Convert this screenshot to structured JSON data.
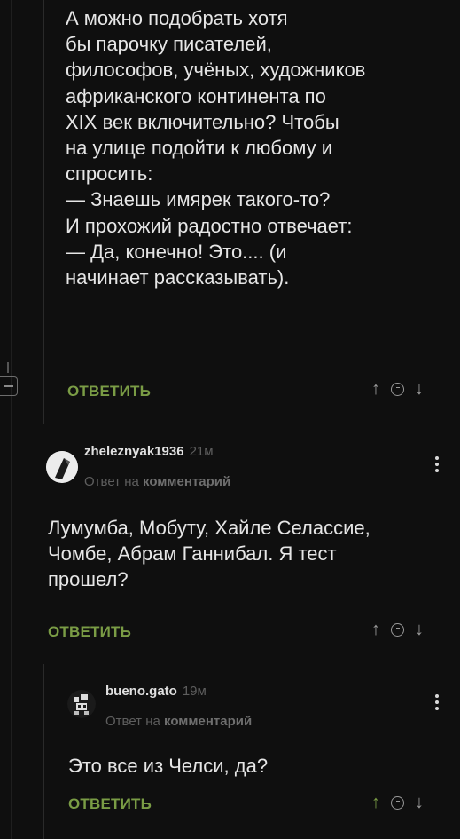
{
  "comments": [
    {
      "text": "А можно подобрать хотя\nбы парочку писателей,\nфилософов, учёных, художников\nафриканского континента по\nXIX век включительно? Чтобы\nна улице подойти к любому и\nспросить:\n— Знаешь имярек такого-то?\nИ прохожий радостно отвечает:\n— Да, конечно! Это.... (и\nначинает рассказывать).",
      "reply_label": "ОТВЕТИТЬ"
    },
    {
      "username": "zheleznyak1936",
      "time": "21м",
      "reply_prefix": "Ответ на",
      "reply_target": "комментарий",
      "text": "Лумумба, Мобуту, Хайле Селассие,\nЧомбе, Абрам Ганнибал. Я тест\nпрошел?",
      "reply_label": "ОТВЕТИТЬ"
    },
    {
      "username": "bueno.gato",
      "time": "19м",
      "reply_prefix": "Ответ на",
      "reply_target": "комментарий",
      "text": "Это все из Челси, да?",
      "reply_label": "ОТВЕТИТЬ"
    }
  ],
  "icons": {
    "upvote": "↑",
    "downvote": "↓"
  },
  "colors": {
    "background": "#0f0f0f",
    "accent_green": "#7a9c45",
    "text": "#e6e6e6",
    "muted": "#5e5e5e"
  }
}
